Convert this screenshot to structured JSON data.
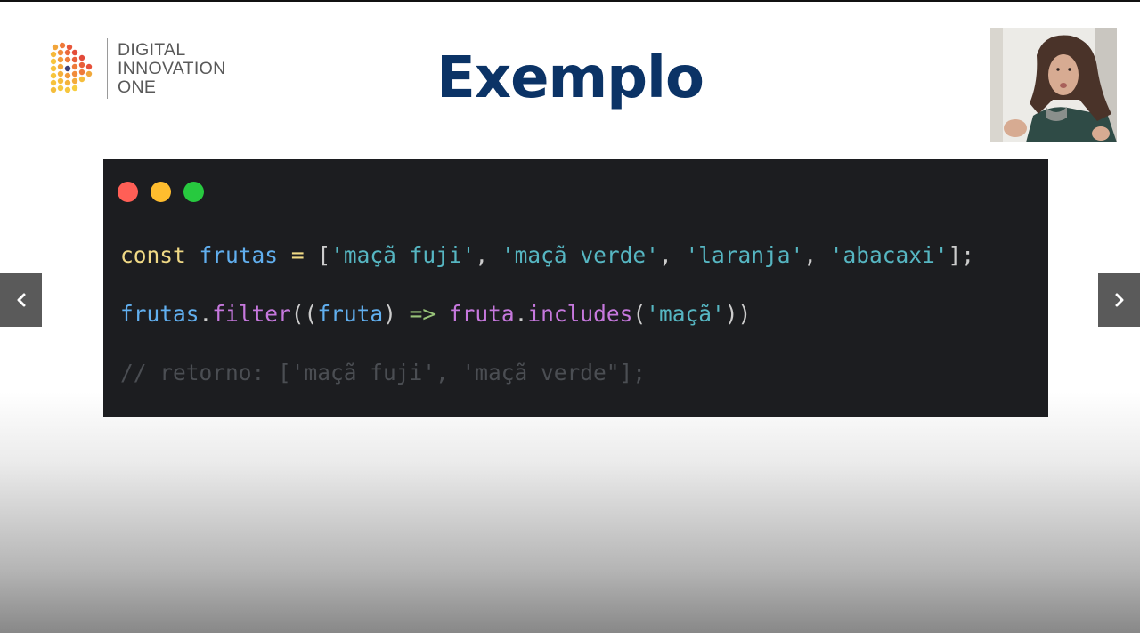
{
  "slide": {
    "title": "Exemplo"
  },
  "logo": {
    "line1": "DIGITAL",
    "line2": "INNOVATION",
    "line3": "ONE"
  },
  "code": {
    "line1": {
      "keyword": "const",
      "variable": "frutas",
      "equals": "=",
      "open_bracket": "[",
      "s1": "'maçã fuji'",
      "comma1": ",",
      "s2": "'maçã verde'",
      "comma2": ",",
      "s3": "'laranja'",
      "comma3": ",",
      "s4": "'abacaxi'",
      "close": "];"
    },
    "line2": {
      "object": "frutas",
      "dot1": ".",
      "method": "filter",
      "open": "((",
      "param": "fruta",
      "close_param": ")",
      "arrow": "=>",
      "arg": "fruta",
      "dot2": ".",
      "method2": "includes",
      "open2": "(",
      "str": "'maçã'",
      "close2": "))"
    },
    "line3": "// retorno: ['maçã fuji', 'maçã verde\"];"
  },
  "window_dots": [
    "red",
    "yellow",
    "green"
  ],
  "nav": {
    "prev_icon": "chevron-left-icon",
    "next_icon": "chevron-right-icon"
  },
  "colors": {
    "title": "#0b3366",
    "code_background": "#1c1d20",
    "keyword": "#f0d985",
    "variable": "#61afef",
    "string": "#56b6c2",
    "function": "#c678dd",
    "arrow": "#98c379",
    "comment": "#4b4e53"
  }
}
